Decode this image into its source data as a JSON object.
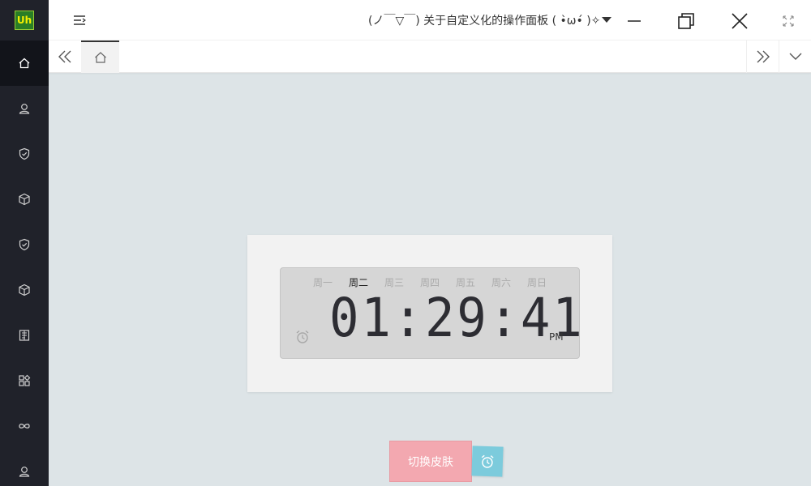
{
  "app": {
    "logo_text": "Uh",
    "title": "(ノ￣▽￣) 关于自定义化的操作面板 ( •̀ω•́ )✧"
  },
  "sidebar": {
    "items": [
      {
        "icon": "home-icon",
        "active": true
      },
      {
        "icon": "user-icon"
      },
      {
        "icon": "shield-check-icon"
      },
      {
        "icon": "cube-icon"
      },
      {
        "icon": "shield-check-icon"
      },
      {
        "icon": "cube-icon"
      },
      {
        "icon": "document-icon"
      },
      {
        "icon": "apps-icon"
      },
      {
        "icon": "infinity-icon"
      },
      {
        "icon": "user-icon"
      }
    ]
  },
  "tabs": [
    {
      "icon": "home-icon",
      "active": true
    }
  ],
  "clock": {
    "weekdays": [
      "周一",
      "周二",
      "周三",
      "周四",
      "周五",
      "周六",
      "周日"
    ],
    "active_weekday": "周二",
    "time": "01:29:41",
    "ampm": "PM"
  },
  "buttons": {
    "switch_skin": "切换皮肤"
  },
  "colors": {
    "sidebar_bg": "#20222a",
    "content_bg": "#dde4e7",
    "skin_button": "#f3a8b0",
    "alarm_button": "#7ccbdc"
  }
}
